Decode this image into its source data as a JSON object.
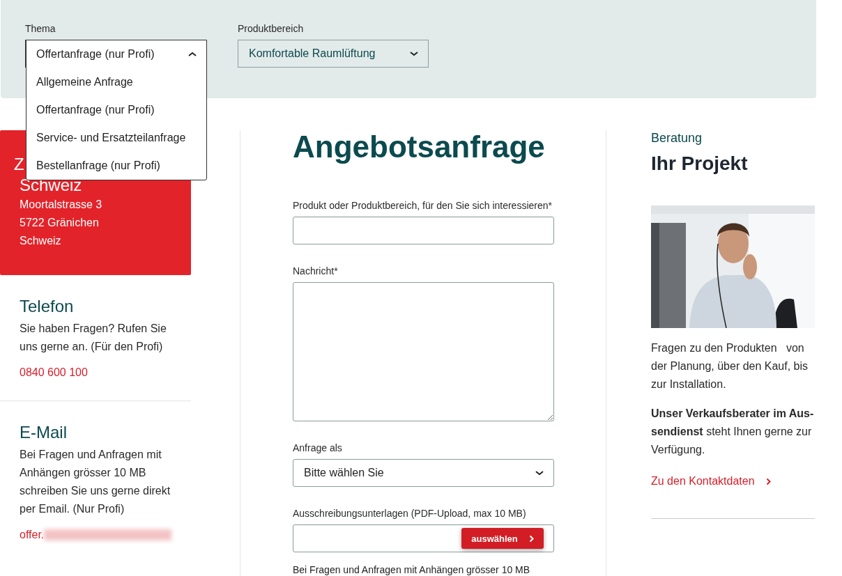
{
  "filters": [
    {
      "label": "Thema",
      "value": "Offertanfrage (nur Profi)",
      "expanded": true,
      "options": [
        "Allgemeine Anfrage",
        "Offertanfrage (nur Profi)",
        "Service- und Ersatzteilanfrage",
        "Bestellanfrage (nur Profi)"
      ]
    },
    {
      "label": "Produktbereich",
      "value": "Komfortable Raumlüftung",
      "expanded": false
    }
  ],
  "address_card": {
    "title_lines": [
      "Z",
      "Schweiz"
    ],
    "lines": [
      "Moortalstrasse 3",
      "5722 Gränichen",
      "Schweiz"
    ]
  },
  "contacts": [
    {
      "title": "Telefon",
      "text": "Sie haben Fragen? Rufen Sie uns gerne an. (Für den Profi)",
      "link": "0840 600 100",
      "redacted": false
    },
    {
      "title": "E-Mail",
      "text": "Bei Fragen und Anfragen mit Anhängen grösser 10 MB schreiben Sie uns gerne direkt per Email. (Nur Profi)",
      "link": "offer.",
      "redacted": true
    }
  ],
  "form": {
    "title": "Angebotsanfrage",
    "fields": [
      {
        "kind": "input",
        "label": "Produkt oder Produktbereich, für den Sie sich interessieren*"
      },
      {
        "kind": "textarea",
        "label": "Nachricht*"
      },
      {
        "kind": "select",
        "label": "Anfrage als",
        "value": "Bitte wählen Sie"
      },
      {
        "kind": "file",
        "label": "Ausschreibungsunterlagen (PDF-Upload, max 10 MB)",
        "button": "auswählen"
      }
    ],
    "note": "Bei Fragen und Anfragen mit Anhängen grösser 10 MB"
  },
  "aside": {
    "kicker": "Beratung",
    "title": "Ihr Projekt",
    "image": {
      "kind": "picture"
    },
    "paragraphs": [
      "Fragen zu den Produkten   von der Planung, über den Kauf, bis zur Installation.",
      "**Unser Verkaufsberater im Aus-sendienst** steht Ihnen gerne zur Verfügung."
    ],
    "link": "Zu den Kontaktdaten"
  }
}
